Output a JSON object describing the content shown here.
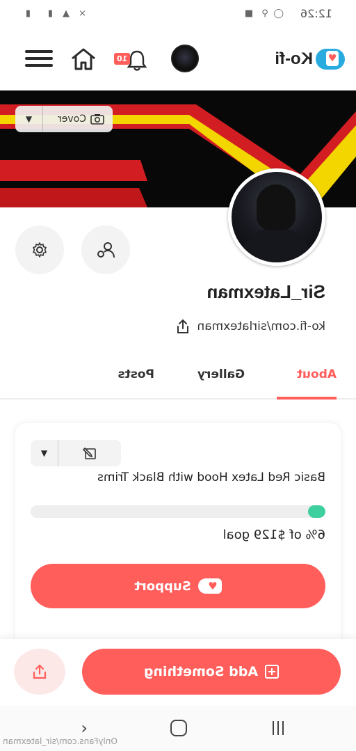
{
  "status_bar": {
    "time": "12:26"
  },
  "header": {
    "logo_text": "Ko-fi",
    "notification_badge": "10"
  },
  "cover": {
    "button_label": "Cover"
  },
  "profile": {
    "username": "Sir_Latexman",
    "url": "ko-fi.com/sirlatexman"
  },
  "tabs": [
    {
      "label": "About",
      "active": true
    },
    {
      "label": "Gallery",
      "active": false
    },
    {
      "label": "Posts",
      "active": false
    }
  ],
  "goal": {
    "title": "Basic Red Latex Hood with Black Trims",
    "progress_percent": 6,
    "progress_text": "6% of $129 goal",
    "support_label": "Support"
  },
  "actions": {
    "add_label": "Add Something"
  },
  "watermark": "OnlyFans.com/sir_latexman",
  "colors": {
    "accent": "#ff5e5b",
    "progress": "#3ecf9f",
    "brand_blue": "#29abe0",
    "cover_yellow": "#f3d500",
    "cover_red": "#d21e22"
  }
}
